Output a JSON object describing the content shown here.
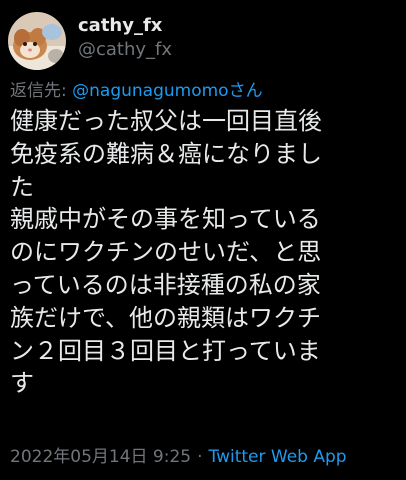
{
  "colors": {
    "background": "#000000",
    "text": "#e7e9ea",
    "secondary_text": "#71767b",
    "accent": "#1d9bf0"
  },
  "author": {
    "display_name": "cathy_fx",
    "handle": "@cathy_fx",
    "avatar_icon": "cat-avatar"
  },
  "reply_to": {
    "prefix": "返信先: ",
    "mention": "@nagunagumomoさん"
  },
  "tweet": {
    "lines": [
      "健康だった叔父は一回目直後",
      "免疫系の難病＆癌になりまし",
      "た",
      "親戚中がその事を知っている",
      "のにワクチンのせいだ、と思",
      "っているのは非接種の私の家",
      "族だけで、他の親類はワクチ",
      "ン２回目３回目と打っていま",
      "す"
    ]
  },
  "meta": {
    "timestamp": "2022年05月14日 9:25",
    "separator": "·",
    "source": "Twitter Web App"
  }
}
